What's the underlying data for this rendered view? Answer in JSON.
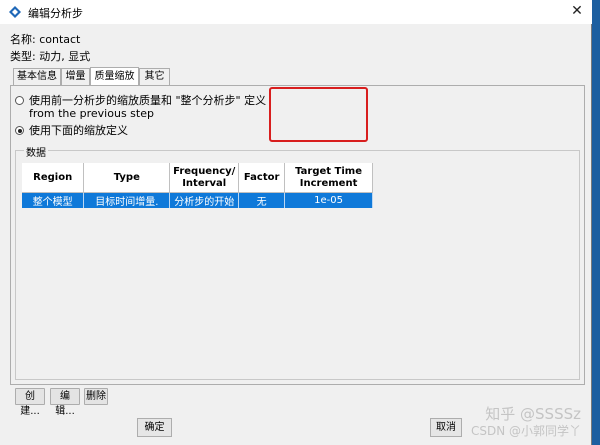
{
  "dialog": {
    "title": "编辑分析步",
    "close_glyph": "✕",
    "name_label": "名称: contact",
    "type_label": "类型: 动力, 显式"
  },
  "tabs": [
    {
      "label": "基本信息",
      "active": false
    },
    {
      "label": "增量",
      "active": false
    },
    {
      "label": "质量缩放",
      "active": true
    },
    {
      "label": "其它",
      "active": false
    }
  ],
  "scaling_options": [
    {
      "label": "使用前一分析步的缩放质量和 \"整个分析步\" 定义",
      "label2": "from the previous step",
      "checked": false
    },
    {
      "label": "使用下面的缩放定义",
      "checked": true
    }
  ],
  "data_group": {
    "legend": "数据",
    "columns": [
      "Region",
      "Type",
      "Frequency/\nInterval",
      "Factor",
      "Target Time\nIncrement"
    ],
    "rows": [
      [
        "整个模型",
        "目标时间增量.",
        "分析步的开始",
        "无",
        "1e-05"
      ]
    ]
  },
  "table_actions": {
    "create": "创建...",
    "edit": "编辑...",
    "delete": "删除"
  },
  "footer": {
    "ok": "确定",
    "cancel": "取消"
  },
  "watermark": {
    "line1": "知乎 @SSSSz",
    "line2": "CSDN @小郭同学丫"
  },
  "colors": {
    "selection": "#0f79d9",
    "highlight_box": "#d81e1e",
    "desktop": "#1d5fa0"
  }
}
